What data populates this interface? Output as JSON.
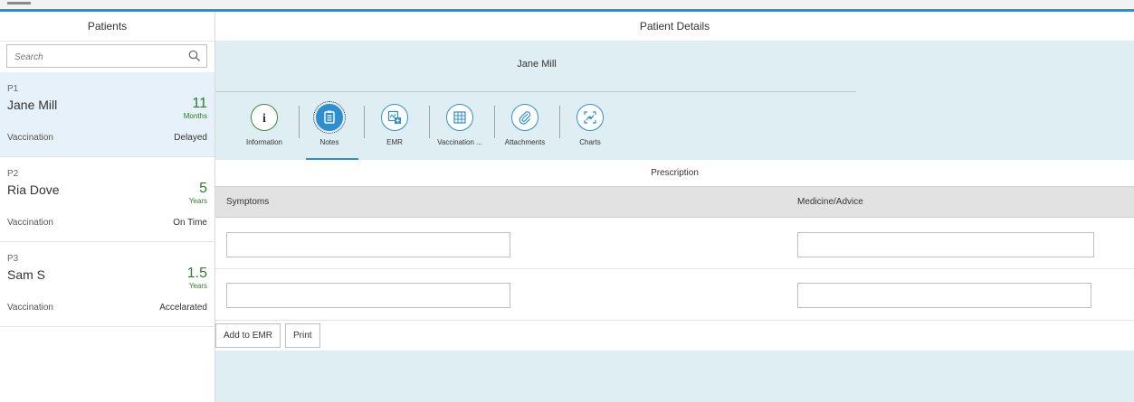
{
  "master": {
    "title": "Patients",
    "search": {
      "placeholder": "Search",
      "icon": "search-icon"
    },
    "patients": [
      {
        "id": "P1",
        "name": "Jane Mill",
        "age": "11",
        "age_unit": "Months",
        "vacc_label": "Vaccination",
        "vacc_status": "Delayed"
      },
      {
        "id": "P2",
        "name": "Ria Dove",
        "age": "5",
        "age_unit": "Years",
        "vacc_label": "Vaccination",
        "vacc_status": "On Time"
      },
      {
        "id": "P3",
        "name": "Sam S",
        "age": "1.5",
        "age_unit": "Years",
        "vacc_label": "Vaccination",
        "vacc_status": "Accelarated"
      }
    ]
  },
  "detail": {
    "title": "Patient Details",
    "patient_name": "Jane Mill",
    "tabs": [
      {
        "label": "Information",
        "icon": "information-icon"
      },
      {
        "label": "Notes",
        "icon": "notes-icon"
      },
      {
        "label": "EMR",
        "icon": "emr-icon"
      },
      {
        "label": "Vaccination ...",
        "icon": "vaccination-grid-icon"
      },
      {
        "label": "Attachments",
        "icon": "paperclip-icon"
      },
      {
        "label": "Charts",
        "icon": "charts-icon"
      }
    ],
    "active_tab": "Notes",
    "prescription": {
      "title": "Prescription",
      "col_symptoms": "Symptoms",
      "col_medicine": "Medicine/Advice",
      "rows": [
        {
          "symptom": "",
          "medicine": ""
        },
        {
          "symptom": "",
          "medicine": ""
        }
      ]
    },
    "buttons": {
      "add_to_emr": "Add to EMR",
      "print": "Print"
    }
  },
  "colors": {
    "accent": "#2d8fd0",
    "header_bg": "#dfeef2",
    "selected_bg": "#e7f1f9",
    "age_green": "#2b7c2b"
  }
}
